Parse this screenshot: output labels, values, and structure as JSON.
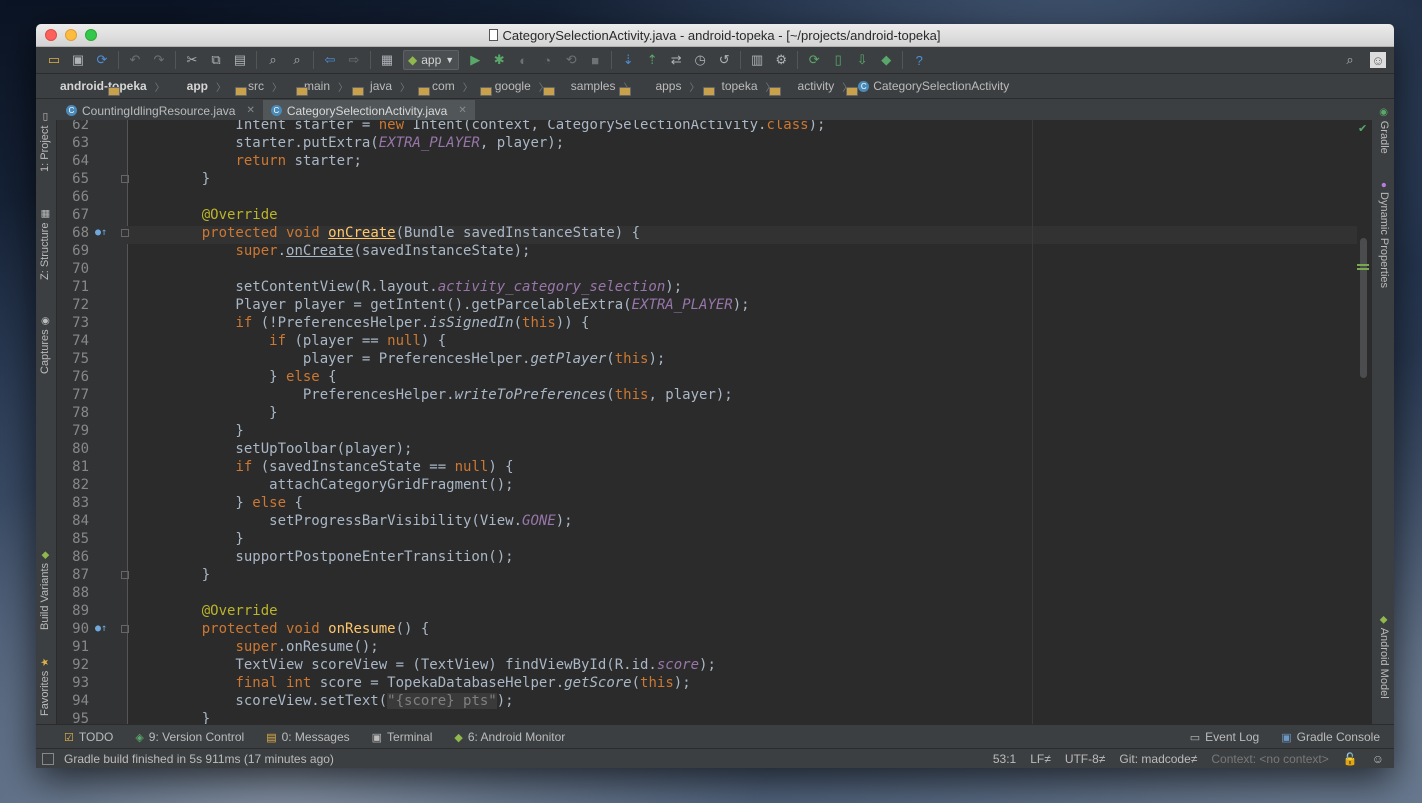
{
  "window": {
    "title": "CategorySelectionActivity.java - android-topeka - [~/projects/android-topeka]"
  },
  "toolbar": {
    "run_config": "app",
    "help": "?"
  },
  "breadcrumbs": [
    {
      "label": "android-topeka",
      "bold": true
    },
    {
      "label": "app",
      "bold": true
    },
    {
      "label": "src"
    },
    {
      "label": "main"
    },
    {
      "label": "java"
    },
    {
      "label": "com"
    },
    {
      "label": "google"
    },
    {
      "label": "samples"
    },
    {
      "label": "apps"
    },
    {
      "label": "topeka"
    },
    {
      "label": "activity"
    },
    {
      "label": "CategorySelectionActivity",
      "class": true
    }
  ],
  "tabs": [
    {
      "label": "CountingIdlingResource.java",
      "active": false
    },
    {
      "label": "CategorySelectionActivity.java",
      "active": true
    }
  ],
  "left_tools": [
    {
      "label": "1: Project",
      "icon": "project-icon"
    },
    {
      "label": "Z: Structure",
      "icon": "structure-icon"
    },
    {
      "label": "Captures",
      "icon": "captures-icon"
    },
    {
      "label": "Build Variants",
      "icon": "android-icon"
    },
    {
      "label": "Favorites",
      "icon": "star-icon"
    }
  ],
  "right_tools": [
    {
      "label": "Gradle",
      "icon": "gradle-icon"
    },
    {
      "label": "Dynamic Properties",
      "icon": "properties-icon"
    },
    {
      "label": "Android Model",
      "icon": "android-icon"
    }
  ],
  "code_lines": [
    {
      "n": "62",
      "html": "        Intent starter = <span class=\"kw\">new</span> Intent(context, CategorySelectionActivity.<span class=\"kw\">class</span>);"
    },
    {
      "n": "63",
      "html": "        starter.putExtra(<span class=\"st\">EXTRA_PLAYER</span>, player);"
    },
    {
      "n": "64",
      "html": "        <span class=\"kw\">return</span> starter;"
    },
    {
      "n": "65",
      "html": "    }",
      "fold": true
    },
    {
      "n": "66",
      "html": ""
    },
    {
      "n": "67",
      "html": "    <span class=\"an\">@Override</span>"
    },
    {
      "n": "68",
      "html": "    <span class=\"kw\">protected void</span> <span class=\"mtu\">onCreate</span>(Bundle savedInstanceState) {",
      "mark": true,
      "fold": true
    },
    {
      "n": "69",
      "html": "        <span class=\"kw\">super</span>.<span class=\"mtu\" style=\"color:#a9b7c6\">onCreate</span>(savedInstanceState);"
    },
    {
      "n": "70",
      "html": ""
    },
    {
      "n": "71",
      "html": "        setContentView(R.layout.<span class=\"st\">activity_category_selection</span>);"
    },
    {
      "n": "72",
      "html": "        Player player = getIntent().getParcelableExtra(<span class=\"st\">EXTRA_PLAYER</span>);"
    },
    {
      "n": "73",
      "html": "        <span class=\"kw\">if</span> (!PreferencesHelper.<span class=\"it\">isSignedIn</span>(<span class=\"kw\">this</span>)) {"
    },
    {
      "n": "74",
      "html": "            <span class=\"kw\">if</span> (player == <span class=\"kw\">null</span>) {"
    },
    {
      "n": "75",
      "html": "                player = PreferencesHelper.<span class=\"it\">getPlayer</span>(<span class=\"kw\">this</span>);"
    },
    {
      "n": "76",
      "html": "            } <span class=\"kw\">else</span> {"
    },
    {
      "n": "77",
      "html": "                PreferencesHelper.<span class=\"it\">writeToPreferences</span>(<span class=\"kw\">this</span>, player);"
    },
    {
      "n": "78",
      "html": "            }"
    },
    {
      "n": "79",
      "html": "        }"
    },
    {
      "n": "80",
      "html": "        setUpToolbar(player);"
    },
    {
      "n": "81",
      "html": "        <span class=\"kw\">if</span> (savedInstanceState == <span class=\"kw\">null</span>) {"
    },
    {
      "n": "82",
      "html": "            attachCategoryGridFragment();"
    },
    {
      "n": "83",
      "html": "        } <span class=\"kw\">else</span> {"
    },
    {
      "n": "84",
      "html": "            setProgressBarVisibility(View.<span class=\"st\">GONE</span>);"
    },
    {
      "n": "85",
      "html": "        }"
    },
    {
      "n": "86",
      "html": "        supportPostponeEnterTransition();"
    },
    {
      "n": "87",
      "html": "    }",
      "fold": true
    },
    {
      "n": "88",
      "html": ""
    },
    {
      "n": "89",
      "html": "    <span class=\"an\">@Override</span>"
    },
    {
      "n": "90",
      "html": "    <span class=\"kw\">protected void</span> <span class=\"mt\">onResume</span>() {",
      "mark": true,
      "fold": true
    },
    {
      "n": "91",
      "html": "        <span class=\"kw\">super</span>.onResume();"
    },
    {
      "n": "92",
      "html": "        TextView scoreView = (TextView) findViewById(R.id.<span class=\"st\">score</span>);"
    },
    {
      "n": "93",
      "html": "        <span class=\"kw\">final int</span> score = TopekaDatabaseHelper.<span class=\"it\">getScore</span>(<span class=\"kw\">this</span>);"
    },
    {
      "n": "94",
      "html": "        scoreView.setText(<span class=\"strpl\">\"{score} pts\"</span>);"
    },
    {
      "n": "95",
      "html": "    }"
    }
  ],
  "bottom_tools": [
    {
      "label": "TODO",
      "icon": "todo-icon"
    },
    {
      "label": "9: Version Control",
      "icon": "vcs-icon"
    },
    {
      "label": "0: Messages",
      "icon": "messages-icon"
    },
    {
      "label": "Terminal",
      "icon": "terminal-icon"
    },
    {
      "label": "6: Android Monitor",
      "icon": "android-icon"
    }
  ],
  "bottom_right_tools": [
    {
      "label": "Event Log"
    },
    {
      "label": "Gradle Console"
    }
  ],
  "status": {
    "message": "Gradle build finished in 5s 911ms (17 minutes ago)",
    "position": "53:1",
    "line_sep": "LF≠",
    "encoding": "UTF-8≠",
    "git": "Git: madcode≠",
    "context": "Context: <no context>"
  }
}
